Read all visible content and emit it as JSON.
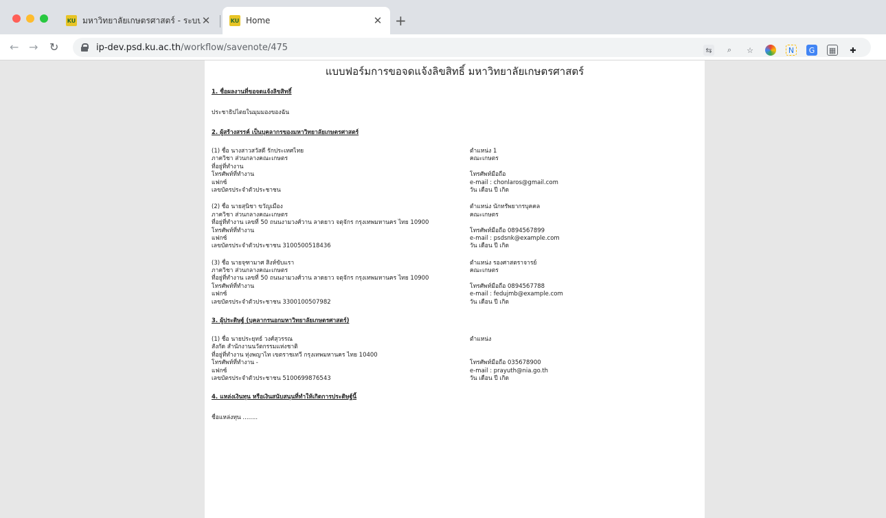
{
  "browser": {
    "tabs": [
      {
        "title": "มหาวิทยาลัยเกษตรศาสตร์ - ระบบจ",
        "icon": "KU",
        "active": false
      },
      {
        "title": "Home",
        "icon": "KU",
        "active": true
      }
    ],
    "url_host": "ip-dev.psd.ku.ac.th",
    "url_path": "/workflow/savenote/475"
  },
  "page": {
    "title": "แบบฟอร์มการขอจดแจ้งลิขสิทธิ์ มหาวิทยาลัยเกษตรศาสตร์",
    "section1": {
      "heading": "1. ชื่อผลงานที่ขอจดแจ้งลิขสิทธิ์",
      "value": "ประชาธิปไตยในมุมมองของฉัน"
    },
    "section2": {
      "heading": "2. ผู้สร้างสรรค์ เป็นบุคลากรของมหาวิทยาลัยเกษตรศาสตร์",
      "people": [
        {
          "name": "(1) ชื่อ นางสาวสวัสดี รักประเทศไทย",
          "dept": "ภาควิชา ส่วนกลางคณะเกษตร",
          "address": "ที่อยู่ที่ทำงาน",
          "phone": "โทรศัพท์ที่ทำงาน",
          "fax": "แฟกซ์",
          "id": "เลขบัตรประจำตัวประชาชน",
          "position": "ตำแหน่ง 1",
          "faculty": "คณะเกษตร",
          "mobile": "โทรศัพท์มือถือ",
          "email": "e-mail : chonlaros@gmail.com",
          "dob": "วัน เดือน ปี เกิด"
        },
        {
          "name": "(2) ชื่อ นายสุนิชา ขวัญเมือง",
          "dept": "ภาควิชา ส่วนกลางคณะเกษตร",
          "address": "ที่อยู่ที่ทำงาน เลขที่ 50 ถนนงามวงศ์วาน ลาดยาว จตุจักร กรุงเทพมหานคร ไทย 10900",
          "phone": "โทรศัพท์ที่ทำงาน",
          "fax": "แฟกซ์",
          "id": "เลขบัตรประจำตัวประชาชน 3100500518436",
          "position": "ตำแหน่ง นักทรัพยากรบุคคล",
          "faculty": "คณะเกษตร",
          "mobile": "โทรศัพท์มือถือ 0894567899",
          "email": "e-mail : psdsnk@example.com",
          "dob": "วัน เดือน ปี เกิด"
        },
        {
          "name": "(3) ชื่อ นายจุฑามาศ สิงห์ขับแรา",
          "dept": "ภาควิชา ส่วนกลางคณะเกษตร",
          "address": "ที่อยู่ที่ทำงาน เลขที่ 50 ถนนงามวงศ์วาน ลาดยาว จตุจักร กรุงเทพมหานคร ไทย 10900",
          "phone": "โทรศัพท์ที่ทำงาน",
          "fax": "แฟกซ์",
          "id": "เลขบัตรประจำตัวประชาชน 3300100507982",
          "position": "ตำแหน่ง รองศาสตราจารย์",
          "faculty": "คณะเกษตร",
          "mobile": "โทรศัพท์มือถือ 0894567788",
          "email": "e-mail : fedujmb@example.com",
          "dob": "วัน เดือน ปี เกิด"
        }
      ]
    },
    "section3": {
      "heading": "3. ผู้ประดิษฐ์ (บุคลากรนอกมหาวิทยาลัยเกษตรศาสตร์)",
      "people": [
        {
          "name": "(1) ชื่อ นายประยุทธ์ วงศ์สุวรรณ",
          "dept": "สังกัด สำนักงานนวัตกรรมแห่งชาติ",
          "address": "ที่อยู่ที่ทำงาน ทุ่งพญาไท เขตราชเทวี กรุงเทพมหานคร ไทย 10400",
          "phone": "โทรศัพท์ที่ทำงาน -",
          "fax": "แฟกซ์",
          "id": "เลขบัตรประจำตัวประชาชน 5100699876543",
          "position": "ตำแหน่ง",
          "faculty": "",
          "mobile": "โทรศัพท์มือถือ 035678900",
          "email": "e-mail : prayuth@nia.go.th",
          "dob": "วัน เดือน ปี เกิด"
        }
      ]
    },
    "section4": {
      "heading": "4. แหล่งเงินทุน หรือเงินสนับสนุนที่ทำให้เกิดการประดิษฐ์นี้",
      "line1": "ชื่อแหล่งทุน ........"
    }
  }
}
